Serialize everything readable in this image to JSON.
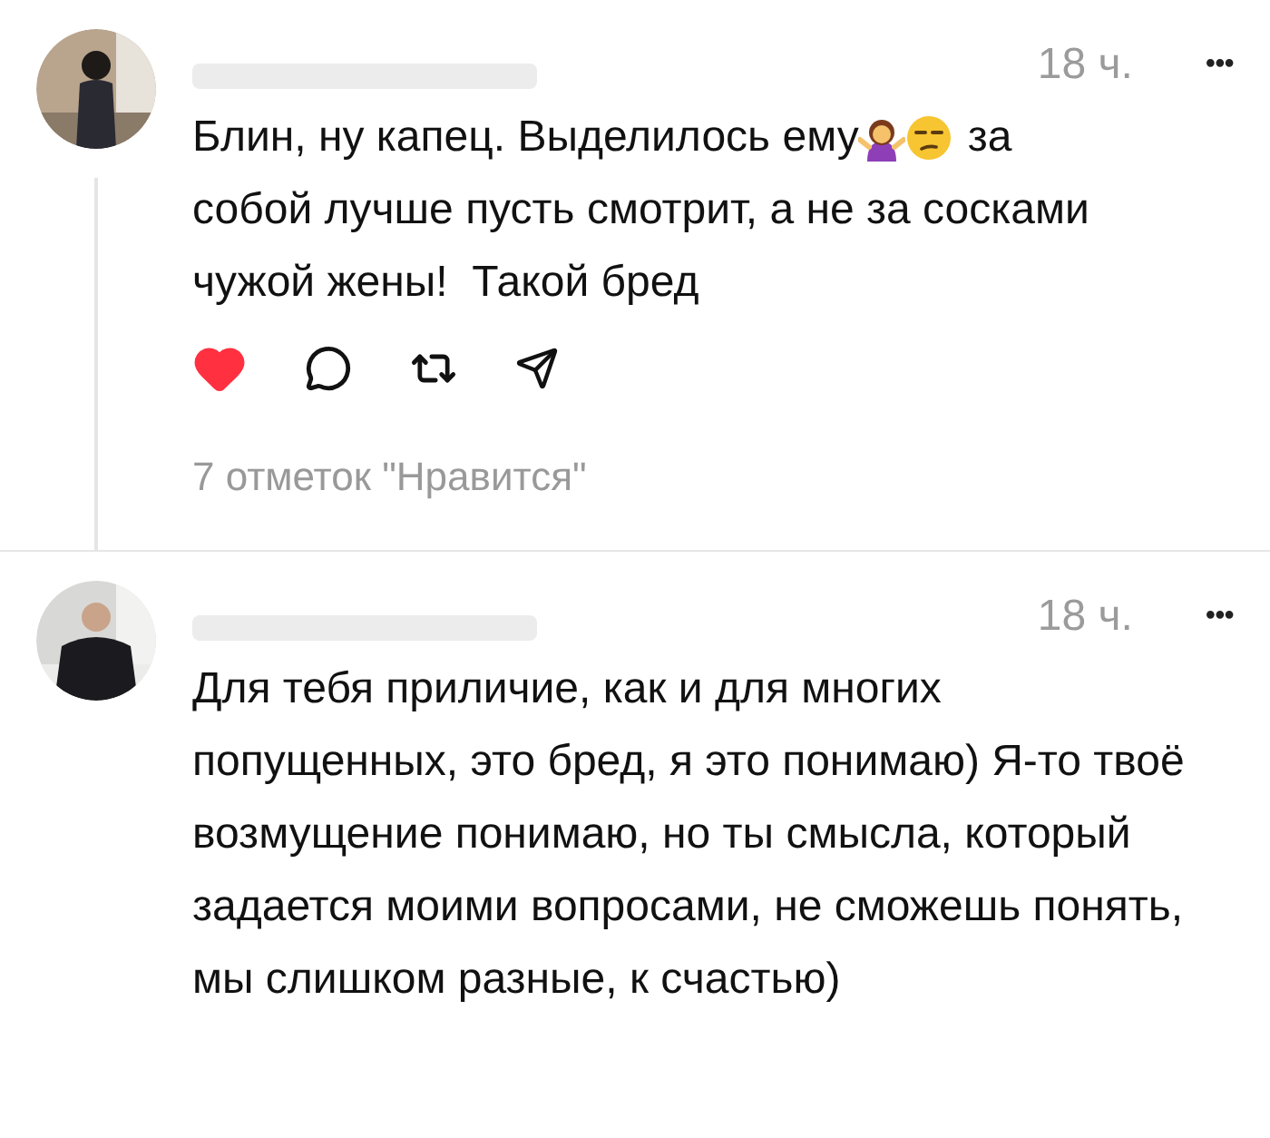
{
  "comments": [
    {
      "time": "18 ч.",
      "more": "•••",
      "text_start": "Блин, ну капец. Выделилось ему",
      "text_after_emoji": "за",
      "text_end": "собой лучше пусть смотрит, а не за сосками чужой жены!  Такой бред",
      "actions": {
        "liked": true
      },
      "likes": "7 отметок \"Нравится\""
    },
    {
      "time": "18 ч.",
      "more": "•••",
      "text_end": "Для тебя приличие, как и для многих попущенных, это бред, я это понимаю) Я-то твоё возмущение понимаю, но ты смысла, который задается моими вопросами, не сможешь понять, мы слишком разные, к счастью)"
    }
  ]
}
